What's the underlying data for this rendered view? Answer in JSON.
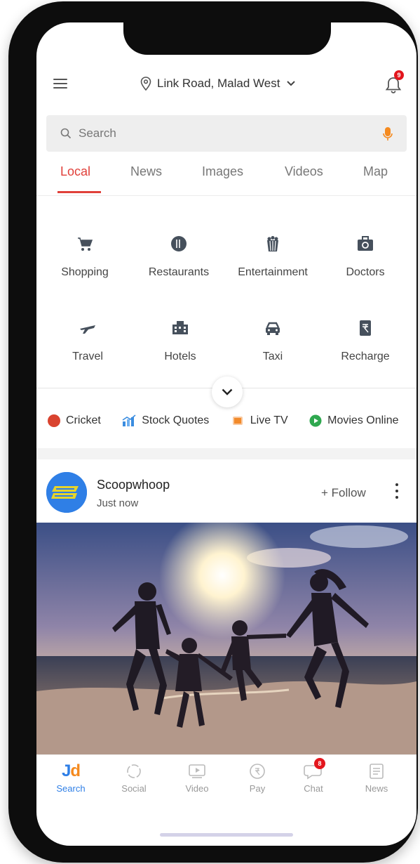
{
  "header": {
    "location": "Link Road, Malad West",
    "notification_count": "9"
  },
  "search": {
    "placeholder": "Search"
  },
  "tabs": [
    {
      "label": "Local",
      "active": true
    },
    {
      "label": "News",
      "active": false
    },
    {
      "label": "Images",
      "active": false
    },
    {
      "label": "Videos",
      "active": false
    },
    {
      "label": "Map",
      "active": false
    }
  ],
  "categories": [
    {
      "label": "Shopping",
      "icon": "cart-icon"
    },
    {
      "label": "Restaurants",
      "icon": "plate-icon"
    },
    {
      "label": "Entertainment",
      "icon": "popcorn-icon"
    },
    {
      "label": "Doctors",
      "icon": "medical-kit-icon"
    },
    {
      "label": "Travel",
      "icon": "airplane-icon"
    },
    {
      "label": "Hotels",
      "icon": "hotel-icon"
    },
    {
      "label": "Taxi",
      "icon": "taxi-icon"
    },
    {
      "label": "Recharge",
      "icon": "recharge-icon"
    }
  ],
  "quick_links": [
    {
      "label": "Cricket",
      "color": "#d9432f"
    },
    {
      "label": "Stock Quotes",
      "color": "#3b8de0"
    },
    {
      "label": "Live TV",
      "color": "#f28a2a"
    },
    {
      "label": "Movies Online",
      "color": "#2fa84f"
    }
  ],
  "post": {
    "author": "Scoopwhoop",
    "time": "Just now",
    "follow_label": "+ Follow"
  },
  "bottom_nav": [
    {
      "label": "Search",
      "active": true
    },
    {
      "label": "Social",
      "active": false
    },
    {
      "label": "Video",
      "active": false
    },
    {
      "label": "Pay",
      "active": false
    },
    {
      "label": "Chat",
      "active": false,
      "badge": "8"
    },
    {
      "label": "News",
      "active": false
    }
  ],
  "colors": {
    "accent": "#e0403a",
    "brand_blue": "#2f7fe6",
    "brand_orange": "#f58a1f"
  }
}
